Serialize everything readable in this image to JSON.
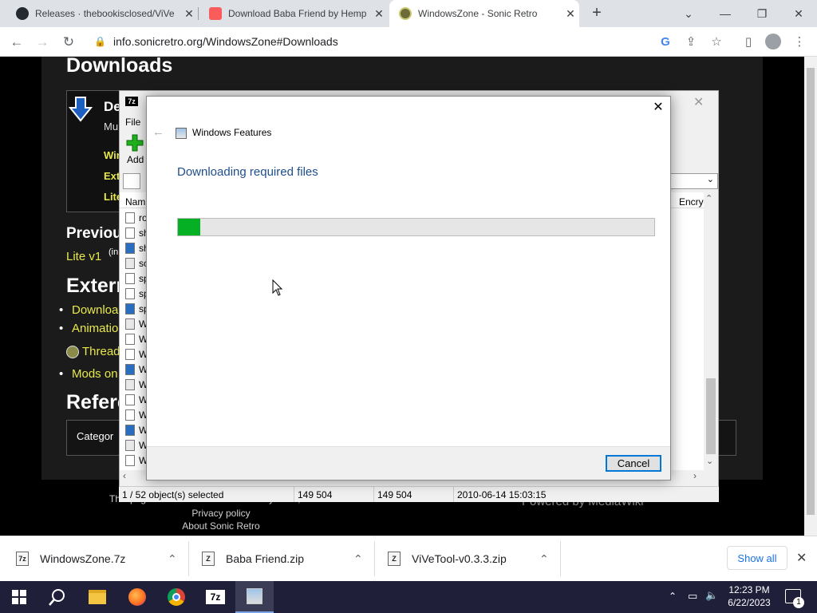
{
  "browser": {
    "tabs": [
      {
        "title": "Releases · thebookisclosed/ViVe",
        "icon": "github-icon"
      },
      {
        "title": "Download Baba Friend by Hemp",
        "icon": "itch-icon"
      },
      {
        "title": "WindowsZone - Sonic Retro",
        "icon": "sonic-retro-icon"
      }
    ],
    "new_tab": "+",
    "url": "info.sonicretro.org/WindowsZone#Downloads"
  },
  "page": {
    "heading_downloads": "Downloads",
    "download_box_title": "De",
    "download_box_sub": "Mu",
    "download_box_links": [
      "Win",
      "Ext",
      "Lite"
    ],
    "heading_previous": "Previou",
    "previous_line": "Lite v1",
    "previous_line_suffix": "(in",
    "heading_external": "Extern",
    "external_links": [
      "Downloa",
      "Animatio"
    ],
    "thread_link": "Thread",
    "mods_link": "Mods on",
    "heading_references": "Refere",
    "categories_label": "Categor",
    "footer_line": "This page was last modified on 14 July 2021, at 04:47.",
    "footer_links": [
      "Privacy policy",
      "About Sonic Retro"
    ],
    "powered_by": "Powered by MediaWiki"
  },
  "sevenzip": {
    "app_badge": "7z",
    "menu_file": "File",
    "add_label": "Add",
    "col_name": "Nam",
    "col_encrypted": "Encry",
    "rows": [
      "ro",
      "sh",
      "sh",
      "sc",
      "sp",
      "sp",
      "sp",
      "W",
      "W",
      "W",
      "W",
      "W",
      "W",
      "W",
      "W",
      "W",
      "W"
    ],
    "status": {
      "selected": "1 / 52 object(s) selected",
      "size": "149 504",
      "packed": "149 504",
      "modified": "2010-06-14 15:03:15"
    }
  },
  "dialog": {
    "title": "Windows Features",
    "heading": "Downloading required files",
    "progress_fraction": 0.047,
    "cancel": "Cancel",
    "colors": {
      "heading": "#1e4e8c",
      "progress": "#06b025"
    }
  },
  "downloads_shelf": {
    "items": [
      "WindowsZone.7z",
      "Baba Friend.zip",
      "ViVeTool-v0.3.3.zip"
    ],
    "show_all": "Show all"
  },
  "taskbar": {
    "time": "12:23 PM",
    "date": "6/22/2023",
    "notification_count": "1",
    "apps": [
      "start",
      "search",
      "file-explorer",
      "firefox",
      "chrome",
      "7zip",
      "windows-features"
    ]
  }
}
